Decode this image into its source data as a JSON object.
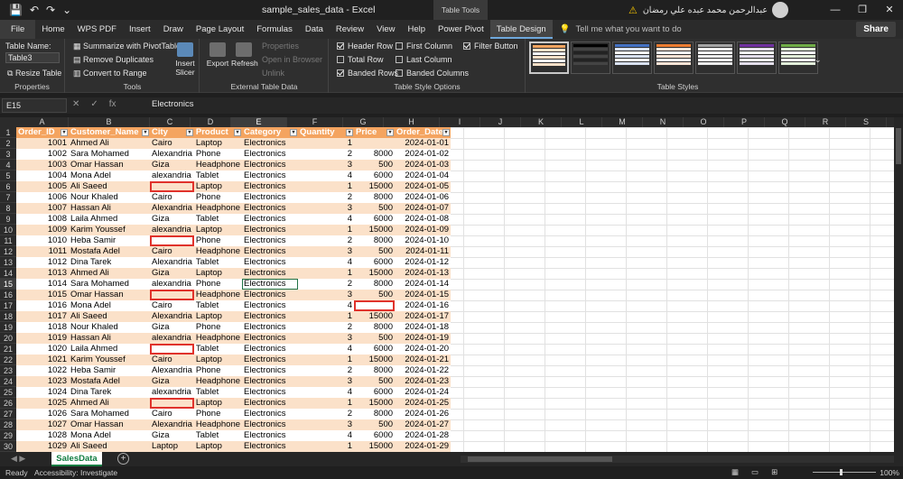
{
  "window": {
    "title": "sample_sales_data  -  Excel",
    "context_label": "Table Tools",
    "user_name": "عبدالرحمن محمد عبده علي رمضان",
    "controls": [
      "—",
      "❐",
      "✕"
    ]
  },
  "ribbon_tabs": [
    "File",
    "Home",
    "WPS PDF",
    "Insert",
    "Draw",
    "Page Layout",
    "Formulas",
    "Data",
    "Review",
    "View",
    "Help",
    "Power Pivot",
    "Table Design"
  ],
  "active_tab": "Table Design",
  "tell_me": "Tell me what you want to do",
  "share_label": "Share",
  "ribbon": {
    "properties": {
      "table_name_label": "Table Name:",
      "table_name_value": "Table3",
      "resize_label": "Resize Table",
      "group_label": "Properties"
    },
    "tools": {
      "summarize": "Summarize with PivotTable",
      "remove_duplicates": "Remove Duplicates",
      "convert_range": "Convert to Range",
      "insert_slicer": "Insert Slicer",
      "group_label": "Tools"
    },
    "external": {
      "export": "Export",
      "refresh": "Refresh",
      "properties": "Properties",
      "open_browser": "Open in Browser",
      "unlink": "Unlink",
      "group_label": "External Table Data"
    },
    "style_options": {
      "header_row": "Header Row",
      "total_row": "Total Row",
      "banded_rows": "Banded Rows",
      "first_column": "First Column",
      "last_column": "Last Column",
      "banded_columns": "Banded Columns",
      "filter_button": "Filter Button",
      "group_label": "Table Style Options"
    },
    "table_styles_label": "Table Styles"
  },
  "formula_bar": {
    "name_box": "E15",
    "value": "Electronics"
  },
  "column_letters": [
    "A",
    "B",
    "C",
    "D",
    "E",
    "F",
    "G",
    "H",
    "I",
    "J",
    "K",
    "L",
    "M",
    "N",
    "O",
    "P",
    "Q",
    "R",
    "S"
  ],
  "row_numbers": [
    "1",
    "2",
    "3",
    "4",
    "5",
    "6",
    "7",
    "8",
    "9",
    "10",
    "11",
    "12",
    "13",
    "14",
    "15",
    "16",
    "17",
    "18",
    "19",
    "20",
    "21",
    "22",
    "23",
    "24",
    "25",
    "26",
    "27",
    "28",
    "29",
    "30"
  ],
  "table": {
    "headers": [
      "Order_ID",
      "Customer_Name",
      "City",
      "Product",
      "Category",
      "Quantity",
      "Price",
      "Order_Date"
    ],
    "rows": [
      [
        "1001",
        "Ahmed Ali",
        "Cairo",
        "Laptop",
        "Electronics",
        "1",
        "",
        "2024-01-01"
      ],
      [
        "1002",
        "Sara Mohamed",
        "Alexandria",
        "Phone",
        "Electronics",
        "2",
        "8000",
        "2024-01-02"
      ],
      [
        "1003",
        "Omar Hassan",
        "Giza",
        "Headphone",
        "Electronics",
        "3",
        "500",
        "2024-01-03"
      ],
      [
        "1004",
        "Mona Adel",
        "alexandria",
        "Tablet",
        "Electronics",
        "4",
        "6000",
        "2024-01-04"
      ],
      [
        "1005",
        "Ali Saeed",
        "",
        "Laptop",
        "Electronics",
        "1",
        "15000",
        "2024-01-05"
      ],
      [
        "1006",
        "Nour Khaled",
        "Cairo",
        "Phone",
        "Electronics",
        "2",
        "8000",
        "2024-01-06"
      ],
      [
        "1007",
        "Hassan Ali",
        "Alexandria",
        "Headphone",
        "Electronics",
        "3",
        "500",
        "2024-01-07"
      ],
      [
        "1008",
        "Laila Ahmed",
        "Giza",
        "Tablet",
        "Electronics",
        "4",
        "6000",
        "2024-01-08"
      ],
      [
        "1009",
        "Karim Youssef",
        "alexandria",
        "Laptop",
        "Electronics",
        "1",
        "15000",
        "2024-01-09"
      ],
      [
        "1010",
        "Heba Samir",
        "",
        "Phone",
        "Electronics",
        "2",
        "8000",
        "2024-01-10"
      ],
      [
        "1011",
        "Mostafa Adel",
        "Cairo",
        "Headphone",
        "Electronics",
        "3",
        "500",
        "2024-01-11"
      ],
      [
        "1012",
        "Dina Tarek",
        "Alexandria",
        "Tablet",
        "Electronics",
        "4",
        "6000",
        "2024-01-12"
      ],
      [
        "1013",
        "Ahmed Ali",
        "Giza",
        "Laptop",
        "Electronics",
        "1",
        "15000",
        "2024-01-13"
      ],
      [
        "1014",
        "Sara Mohamed",
        "alexandria",
        "Phone",
        "Electronics",
        "2",
        "8000",
        "2024-01-14"
      ],
      [
        "1015",
        "Omar Hassan",
        "",
        "Headphone",
        "Electronics",
        "3",
        "500",
        "2024-01-15"
      ],
      [
        "1016",
        "Mona Adel",
        "Cairo",
        "Tablet",
        "Electronics",
        "4",
        "",
        "2024-01-16"
      ],
      [
        "1017",
        "Ali Saeed",
        "Alexandria",
        "Laptop",
        "Electronics",
        "1",
        "15000",
        "2024-01-17"
      ],
      [
        "1018",
        "Nour Khaled",
        "Giza",
        "Phone",
        "Electronics",
        "2",
        "8000",
        "2024-01-18"
      ],
      [
        "1019",
        "Hassan Ali",
        "alexandria",
        "Headphone",
        "Electronics",
        "3",
        "500",
        "2024-01-19"
      ],
      [
        "1020",
        "Laila Ahmed",
        "",
        "Tablet",
        "Electronics",
        "4",
        "6000",
        "2024-01-20"
      ],
      [
        "1021",
        "Karim Youssef",
        "Cairo",
        "Laptop",
        "Electronics",
        "1",
        "15000",
        "2024-01-21"
      ],
      [
        "1022",
        "Heba Samir",
        "Alexandria",
        "Phone",
        "Electronics",
        "2",
        "8000",
        "2024-01-22"
      ],
      [
        "1023",
        "Mostafa Adel",
        "Giza",
        "Headphone",
        "Electronics",
        "3",
        "500",
        "2024-01-23"
      ],
      [
        "1024",
        "Dina Tarek",
        "alexandria",
        "Tablet",
        "Electronics",
        "4",
        "6000",
        "2024-01-24"
      ],
      [
        "1025",
        "Ahmed Ali",
        "",
        "Laptop",
        "Electronics",
        "1",
        "15000",
        "2024-01-25"
      ],
      [
        "1026",
        "Sara Mohamed",
        "Cairo",
        "Phone",
        "Electronics",
        "2",
        "8000",
        "2024-01-26"
      ],
      [
        "1027",
        "Omar Hassan",
        "Alexandria",
        "Headphone",
        "Electronics",
        "3",
        "500",
        "2024-01-27"
      ],
      [
        "1028",
        "Mona Adel",
        "Giza",
        "Tablet",
        "Electronics",
        "4",
        "6000",
        "2024-01-28"
      ],
      [
        "1029",
        "Ali Saeed",
        "Laptop",
        "Laptop",
        "Electronics",
        "1",
        "15000",
        "2024-01-29"
      ]
    ]
  },
  "sheet_tab": "SalesData",
  "status": {
    "ready": "Ready",
    "accessibility": "Accessibility: Investigate",
    "zoom": "100%"
  },
  "colors": {
    "header_orange": "#f4a460",
    "band_light": "#fbe1c9",
    "missing_highlight": "#e0322b",
    "excel_green": "#107c41"
  }
}
